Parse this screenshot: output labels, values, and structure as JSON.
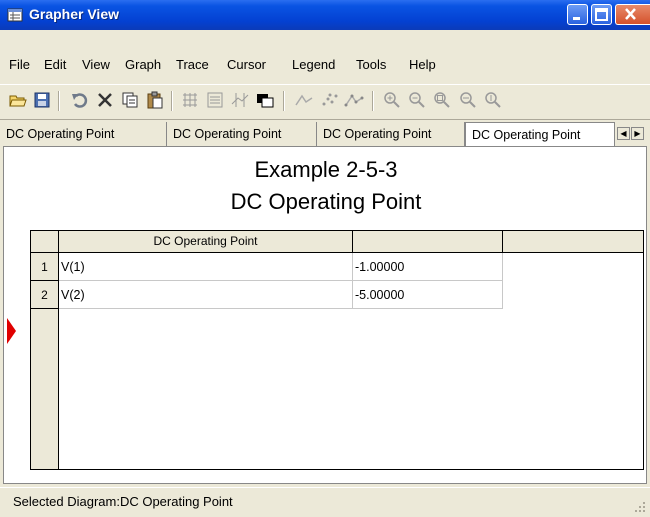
{
  "window": {
    "title": "Grapher View"
  },
  "menu": [
    "File",
    "Edit",
    "View",
    "Graph",
    "Trace",
    "Cursor",
    "Legend",
    "Tools",
    "Help"
  ],
  "toolbar": [
    "open-icon",
    "save-icon",
    "undo-icon",
    "delete-icon",
    "copy-icon",
    "paste-icon",
    "grid-icon",
    "legend-icon",
    "cursors-icon",
    "invert-colors-icon",
    "traces-icon",
    "scatter-icon",
    "scatter-line-icon",
    "zoom-in-icon",
    "zoom-out-icon",
    "zoom-full-icon",
    "zoom-x-icon",
    "zoom-y-icon"
  ],
  "tabs": [
    {
      "label": "DC Operating Point",
      "active": false
    },
    {
      "label": "DC Operating Point",
      "active": false
    },
    {
      "label": "DC Operating Point",
      "active": false
    },
    {
      "label": "DC Operating Point",
      "active": true
    }
  ],
  "graph": {
    "title_line1": "Example 2-5-3",
    "title_line2": "DC Operating Point",
    "columns": [
      "DC Operating Point",
      "",
      ""
    ],
    "rows": [
      {
        "num": "1",
        "name": "V(1)",
        "value": "-1.00000"
      },
      {
        "num": "2",
        "name": "V(2)",
        "value": "-5.00000"
      }
    ]
  },
  "status": {
    "text": "Selected Diagram:DC Operating Point"
  },
  "colors": {
    "title_bar": "#0a54e3",
    "marker": "#e00000",
    "chrome": "#ece9d8"
  }
}
